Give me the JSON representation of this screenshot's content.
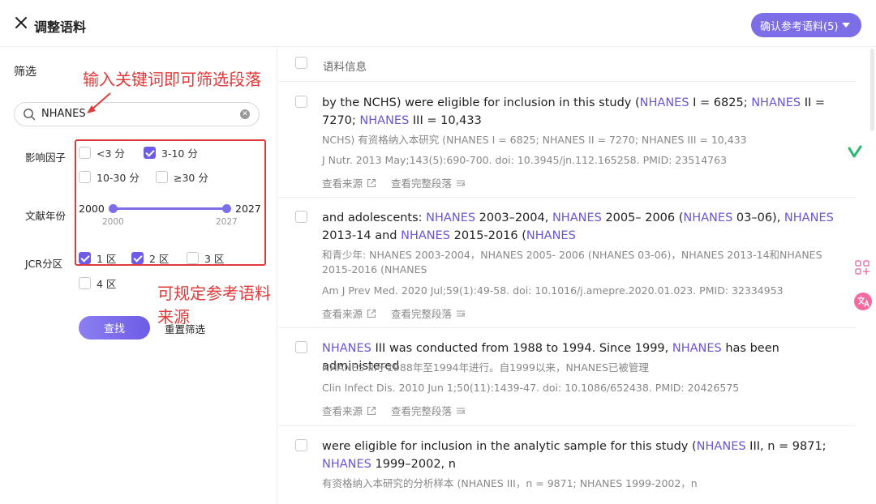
{
  "header": {
    "title": "调整语料",
    "confirm_label": "确认参考语料(5)"
  },
  "sidebar": {
    "filter_title": "筛选",
    "search_value": "NHANES",
    "impact_label": "影响因子",
    "impact_options": [
      {
        "label": "<3 分",
        "checked": false
      },
      {
        "label": "3-10 分",
        "checked": true
      },
      {
        "label": "10-30 分",
        "checked": false
      },
      {
        "label": "≥30 分",
        "checked": false
      }
    ],
    "year_label": "文献年份",
    "year_min": "2000",
    "year_max": "2027",
    "year_min_sub": "2000",
    "year_max_sub": "2027",
    "jcr_label": "JCR分区",
    "jcr_options": [
      {
        "label": "1 区",
        "checked": true
      },
      {
        "label": "2 区",
        "checked": true
      },
      {
        "label": "3 区",
        "checked": false
      },
      {
        "label": "4 区",
        "checked": false
      }
    ],
    "find_label": "查找",
    "reset_label": "重置筛选"
  },
  "annotations": {
    "keyword_hint": "输入关键词即可筛选段落",
    "source_hint": "可规定参考语料来源"
  },
  "main": {
    "header_label": "语料信息",
    "link_source": "查看来源",
    "link_full": "查看完整段落",
    "entries": [
      {
        "en": "by the NCHS) were eligible for inclusion in this study (<span class=\"hl\">NHANES</span> I = 6825; <span class=\"hl\">NHANES</span> II = 7270; <span class=\"hl\">NHANES</span> III = 10,433",
        "zh": "NCHS) 有资格纳入本研究 (NHANES I = 6825; NHANES II = 7270; NHANES III = 10,433",
        "cite": "J Nutr. 2013 May;143(5):690-700. doi: 10.3945/jn.112.165258. PMID: 23514763"
      },
      {
        "en": "and adolescents: <span class=\"hl\">NHANES</span> 2003–2004, <span class=\"hl\">NHANES</span> 2005– 2006 (<span class=\"hl\">NHANES</span> 03–06), <span class=\"hl\">NHANES</span> 2013-14 and <span class=\"hl\">NHANES</span> 2015-2016 (<span class=\"hl\">NHANES</span>",
        "zh": "和青少年: NHANES 2003-2004，NHANES 2005- 2006 (NHANES 03-06)，NHANES 2013-14和NHANES 2015-2016 (NHANES",
        "cite": "Am J Prev Med. 2020 Jul;59(1):49-58. doi: 10.1016/j.amepre.2020.01.023. PMID: 32334953"
      },
      {
        "en": "<span class=\"hl\">NHANES</span> III was conducted from 1988 to 1994. Since 1999, <span class=\"hl\">NHANES</span> has been administered",
        "zh": "NHANES III于1988年至1994年进行。自1999以来，NHANES已被管理",
        "cite": "Clin Infect Dis. 2010 Jun 1;50(11):1439-47. doi: 10.1086/652438. PMID: 20426575"
      },
      {
        "en": "were eligible for inclusion in the analytic sample for this study (<span class=\"hl\">NHANES</span> III, n = 9871; <span class=\"hl\">NHANES</span> 1999–2002, n",
        "zh": "有资格纳入本研究的分析样本 (NHANES III，n = 9871; NHANES 1999-2002，n",
        "cite": ""
      }
    ]
  },
  "colors": {
    "accent": "#7b6ee6",
    "highlight": "#6a55d8",
    "annotation": "#e03a3a"
  }
}
